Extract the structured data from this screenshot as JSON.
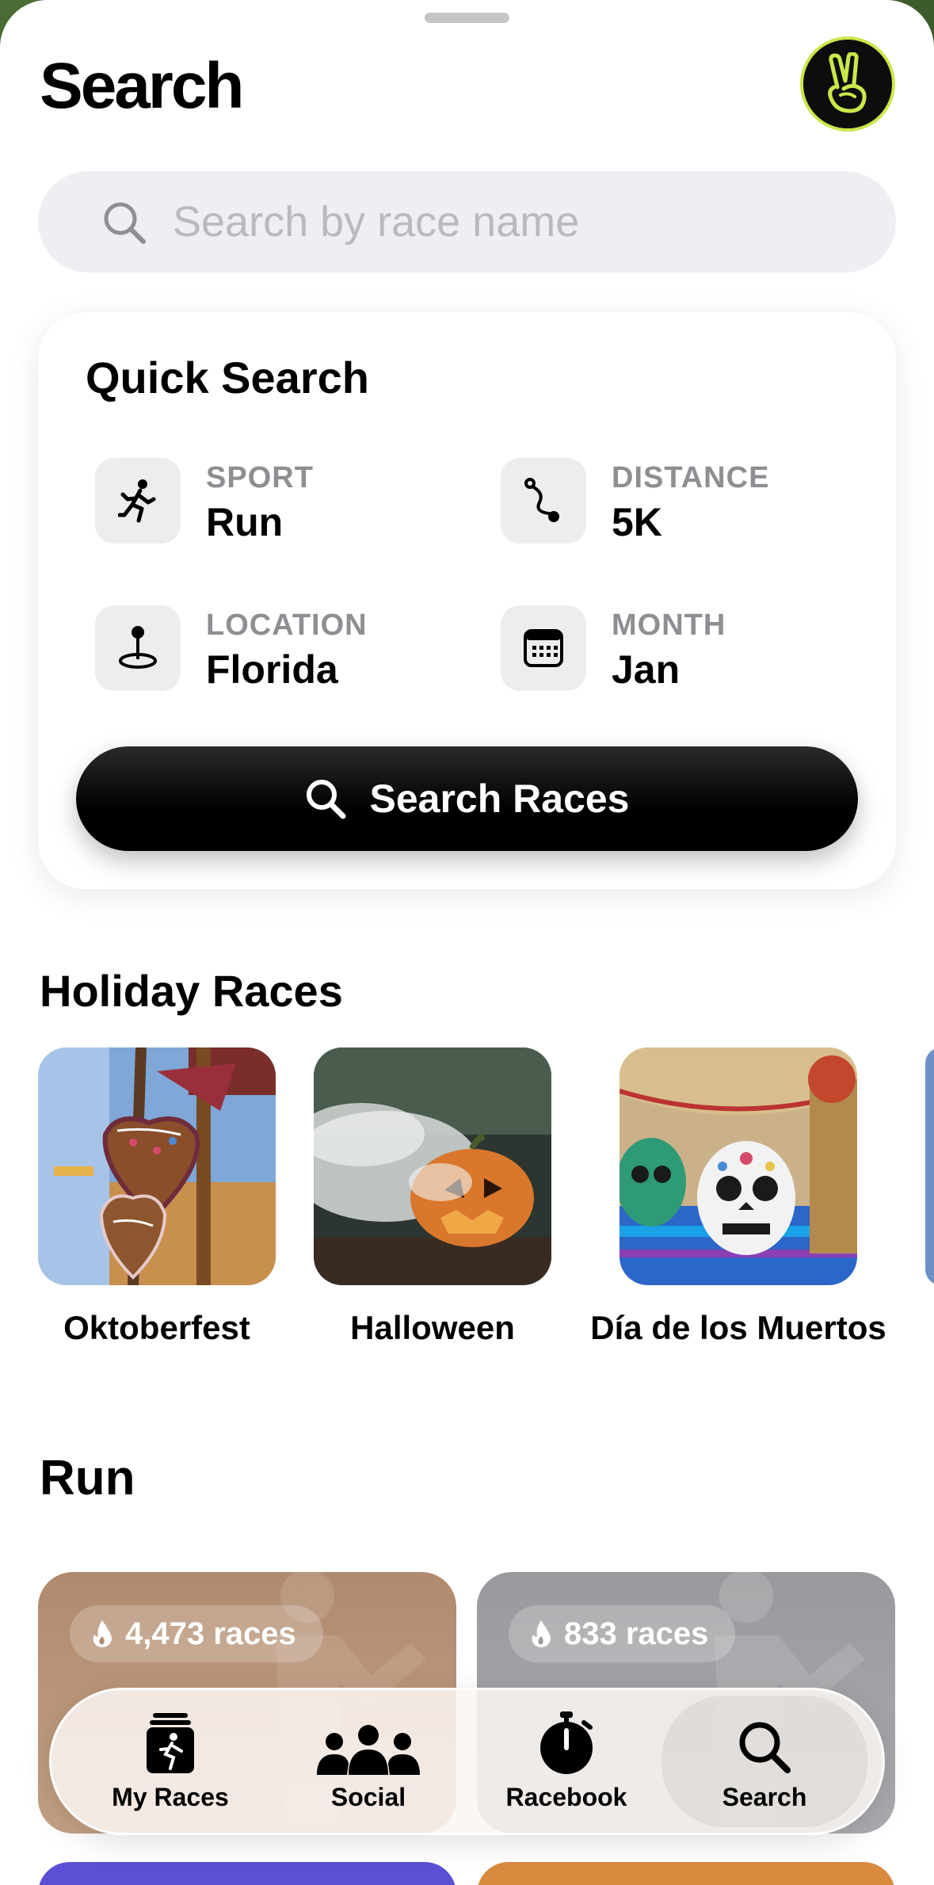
{
  "header": {
    "title": "Search",
    "avatar_icon": "peace-hand-icon",
    "avatar_accent": "#c9e84a"
  },
  "search": {
    "placeholder": "Search by race name",
    "value": ""
  },
  "quick_search": {
    "title": "Quick Search",
    "items": [
      {
        "label": "SPORT",
        "value": "Run",
        "icon": "runner-icon"
      },
      {
        "label": "DISTANCE",
        "value": "5K",
        "icon": "route-icon"
      },
      {
        "label": "LOCATION",
        "value": "Florida",
        "icon": "map-pin-icon"
      },
      {
        "label": "MONTH",
        "value": "Jan",
        "icon": "calendar-icon"
      }
    ],
    "button_label": "Search Races"
  },
  "holiday": {
    "title": "Holiday Races",
    "items": [
      {
        "label": "Oktoberfest"
      },
      {
        "label": "Halloween"
      },
      {
        "label": "Día de los Muertos"
      }
    ]
  },
  "run": {
    "title": "Run",
    "cards": [
      {
        "count": "4,473 races",
        "color": "#b08a6e"
      },
      {
        "count": "833 races",
        "color": "#9a9a9e"
      }
    ]
  },
  "tabbar": {
    "items": [
      {
        "label": "My Races",
        "icon": "my-races-icon"
      },
      {
        "label": "Social",
        "icon": "people-icon"
      },
      {
        "label": "Racebook",
        "icon": "stopwatch-icon"
      },
      {
        "label": "Search",
        "icon": "search-icon",
        "active": true
      }
    ]
  }
}
